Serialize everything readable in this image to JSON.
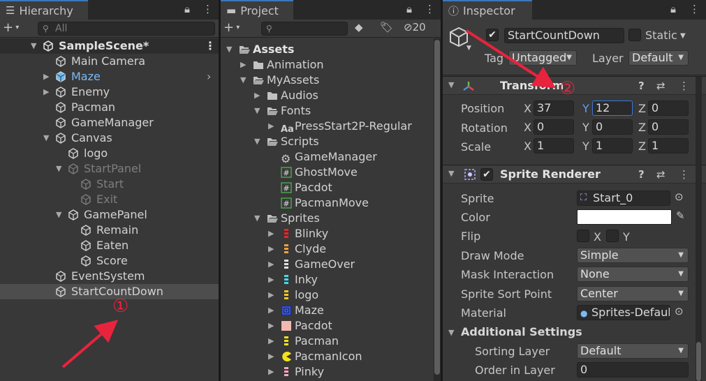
{
  "hierarchy": {
    "tab_label": "Hierarchy",
    "search_placeholder": "All",
    "scene_name": "SampleScene*",
    "items": [
      {
        "label": "Main Camera",
        "state": "normal"
      },
      {
        "label": "Maze",
        "state": "prefab"
      },
      {
        "label": "Enemy",
        "state": "normal"
      },
      {
        "label": "Pacman",
        "state": "normal"
      },
      {
        "label": "GameManager",
        "state": "normal"
      },
      {
        "label": "Canvas",
        "state": "normal"
      },
      {
        "label": "logo",
        "state": "normal"
      },
      {
        "label": "StartPanel",
        "state": "inactive"
      },
      {
        "label": "Start",
        "state": "inactive"
      },
      {
        "label": "Exit",
        "state": "inactive"
      },
      {
        "label": "GamePanel",
        "state": "normal"
      },
      {
        "label": "Remain",
        "state": "normal"
      },
      {
        "label": "Eaten",
        "state": "normal"
      },
      {
        "label": "Score",
        "state": "normal"
      },
      {
        "label": "EventSystem",
        "state": "normal"
      },
      {
        "label": "StartCountDown",
        "state": "selected"
      }
    ]
  },
  "project": {
    "tab_label": "Project",
    "hidden_count": "20",
    "items": [
      {
        "label": "Assets",
        "bold": true
      },
      {
        "label": "Animation"
      },
      {
        "label": "MyAssets"
      },
      {
        "label": "Audios"
      },
      {
        "label": "Fonts"
      },
      {
        "label": "PressStart2P-Regular"
      },
      {
        "label": "Scripts"
      },
      {
        "label": "GameManager"
      },
      {
        "label": "GhostMove"
      },
      {
        "label": "Pacdot"
      },
      {
        "label": "PacmanMove"
      },
      {
        "label": "Sprites"
      },
      {
        "label": "Blinky"
      },
      {
        "label": "Clyde"
      },
      {
        "label": "GameOver"
      },
      {
        "label": "Inky"
      },
      {
        "label": "logo"
      },
      {
        "label": "Maze"
      },
      {
        "label": "Pacdot"
      },
      {
        "label": "Pacman"
      },
      {
        "label": "PacmanIcon"
      },
      {
        "label": "Pinky"
      }
    ]
  },
  "inspector": {
    "tab_label": "Inspector",
    "object_name": "StartCountDown",
    "active": true,
    "static_label": "Static",
    "tag_label": "Tag",
    "tag_value": "Untagged",
    "layer_label": "Layer",
    "layer_value": "Default",
    "transform": {
      "title": "Transform",
      "position_label": "Position",
      "rotation_label": "Rotation",
      "scale_label": "Scale",
      "position": {
        "x": "37",
        "y": "12",
        "z": "0"
      },
      "rotation": {
        "x": "0",
        "y": "0",
        "z": "0"
      },
      "scale": {
        "x": "1",
        "y": "1",
        "z": "1"
      },
      "x_label": "X",
      "y_label": "Y",
      "z_label": "Z"
    },
    "sprite_renderer": {
      "title": "Sprite Renderer",
      "sprite_label": "Sprite",
      "sprite_value": "Start_0",
      "color_label": "Color",
      "color_value": "#ffffff",
      "flip_label": "Flip",
      "flip_x": "X",
      "flip_y": "Y",
      "draw_mode_label": "Draw Mode",
      "draw_mode_value": "Simple",
      "mask_label": "Mask Interaction",
      "mask_value": "None",
      "sort_point_label": "Sprite Sort Point",
      "sort_point_value": "Center",
      "material_label": "Material",
      "material_value": "Sprites-Default",
      "additional_label": "Additional Settings",
      "sorting_layer_label": "Sorting Layer",
      "sorting_layer_value": "Default",
      "order_label": "Order in Layer",
      "order_value": "0"
    }
  },
  "annotations": {
    "one": "①",
    "two": "②",
    "color": "#e8233d"
  }
}
